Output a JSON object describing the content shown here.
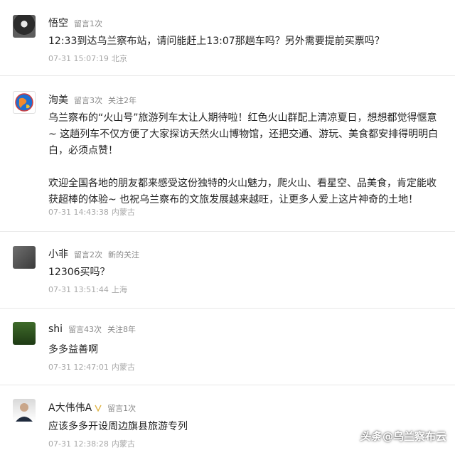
{
  "comments": [
    {
      "name": "悟空",
      "meta1": "留言1次",
      "meta2": "",
      "body": [
        "12:33到达乌兰察布站，请问能赶上13:07那趟车吗？另外需要提前买票吗？"
      ],
      "date": "07-31 15:07:19",
      "location": "北京"
    },
    {
      "name": "洵美",
      "meta1": "留言3次",
      "meta2": "关注2年",
      "body": [
        "乌兰察布的“火山号”旅游列车太让人期待啦！红色火山群配上清凉夏日，想想都觉得惬意~ 这趟列车不仅方便了大家探访天然火山博物馆，还把交通、游玩、美食都安排得明明白白，必须点赞！",
        "欢迎全国各地的朋友都来感受这份独特的火山魅力，爬火山、看星空、品美食，肯定能收获超棒的体验~ 也祝乌兰察布的文旅发展越来越旺，让更多人爱上这片神奇的土地！"
      ],
      "date": "07-31 14:43:38",
      "location": "内蒙古"
    },
    {
      "name": "小非",
      "meta1": "留言2次",
      "meta2": "新的关注",
      "body": [
        "12306买吗？"
      ],
      "date": "07-31 13:51:44",
      "location": "上海"
    },
    {
      "name": "shi",
      "meta1": "留言43次",
      "meta2": "关注8年",
      "body": [
        "多多益善啊"
      ],
      "date": "07-31 12:47:01",
      "location": "内蒙古"
    },
    {
      "name": "A大伟伟A",
      "meta1": "留言1次",
      "meta2": "",
      "body": [
        "应该多多开设周边旗县旅游专列"
      ],
      "date": "07-31 12:38:28",
      "location": "内蒙古"
    }
  ],
  "watermark": {
    "logo": "头条",
    "text": "@乌兰察布云"
  }
}
